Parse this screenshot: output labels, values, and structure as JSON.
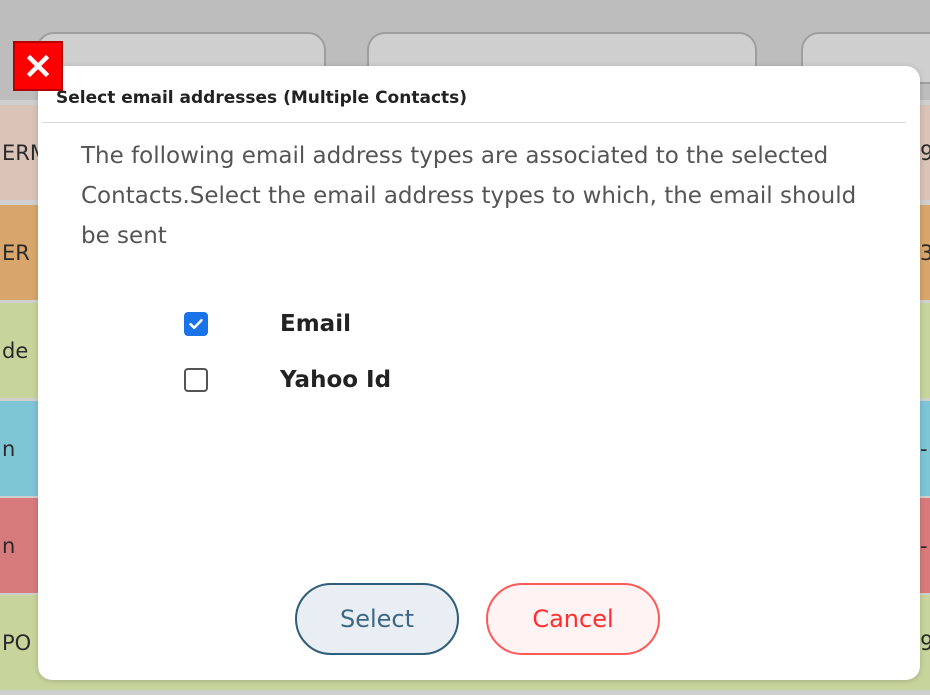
{
  "background": {
    "rows": [
      {
        "left_text": "ERM",
        "right_text": "9",
        "color": "#d8c3b6"
      },
      {
        "left_text": "ER",
        "right_text": "3",
        "color": "#d8a56a"
      },
      {
        "left_text": "de",
        "right_text": "",
        "color": "#c7d49b"
      },
      {
        "left_text": "n",
        "right_text": "-",
        "color": "#7ec5d6"
      },
      {
        "left_text": "n",
        "right_text": "-",
        "color": "#d77a7c"
      },
      {
        "left_text": "PO",
        "right_text": "9",
        "color": "#c7d49b"
      }
    ]
  },
  "dialog": {
    "title": "Select email addresses (Multiple Contacts)",
    "message": "The following email address types are associated to the selected Contacts.Select the email address types to which, the email should be sent",
    "options": [
      {
        "label": "Email",
        "checked": true
      },
      {
        "label": "Yahoo Id",
        "checked": false
      }
    ],
    "buttons": {
      "select": "Select",
      "cancel": "Cancel"
    }
  },
  "icons": {
    "close": "close-icon",
    "checkmark": "checkmark-icon"
  },
  "colors": {
    "close_red": "#ff0000",
    "checkbox_blue": "#1a73e8",
    "select_border": "#2f5d7a",
    "cancel_red": "#ff2d2d"
  }
}
